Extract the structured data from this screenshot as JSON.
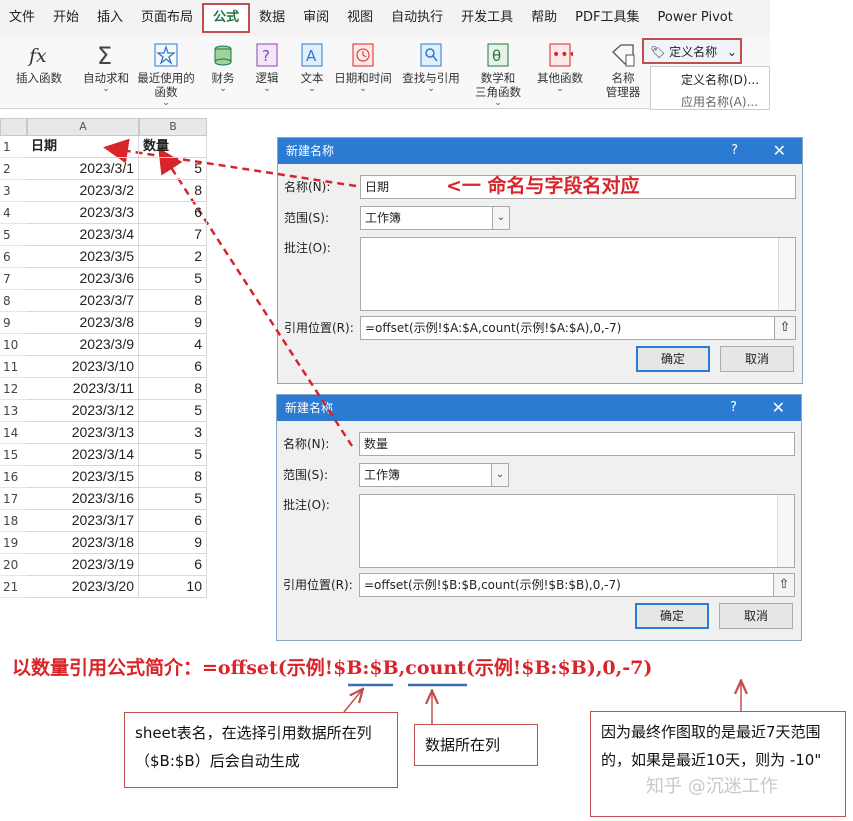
{
  "ribbon": {
    "tabs": [
      "文件",
      "开始",
      "插入",
      "页面布局",
      "公式",
      "数据",
      "审阅",
      "视图",
      "自动执行",
      "开发工具",
      "帮助",
      "PDF工具集",
      "Power Pivot"
    ],
    "active_tab": "公式",
    "buttons": [
      {
        "label": "插入函数",
        "icon": "fx-icon",
        "chevron": ""
      },
      {
        "label": "自动求和",
        "icon": "sigma-icon",
        "chevron": "⌄"
      },
      {
        "label": "最近使用的",
        "label2": "函数",
        "icon": "star-icon",
        "chevron": "⌄"
      },
      {
        "label": "财务",
        "icon": "coins-icon",
        "chevron": "⌄"
      },
      {
        "label": "逻辑",
        "icon": "question-icon",
        "chevron": "⌄"
      },
      {
        "label": "文本",
        "icon": "text-icon",
        "chevron": "⌄"
      },
      {
        "label": "日期和时间",
        "icon": "clock-icon",
        "chevron": "⌄"
      },
      {
        "label": "查找与引用",
        "icon": "search-icon",
        "chevron": "⌄"
      },
      {
        "label": "数学和",
        "label2": "三角函数",
        "icon": "theta-icon",
        "chevron": "⌄"
      },
      {
        "label": "其他函数",
        "icon": "dots-icon",
        "chevron": "⌄"
      },
      {
        "label": "名称",
        "label2": "管理器",
        "icon": "tag-icon",
        "chevron": ""
      }
    ],
    "define_name": "定义名称",
    "define_name_menu": [
      "定义名称(D)...",
      "应用名称(A)..."
    ]
  },
  "sheet": {
    "col_headers": [
      "A",
      "B"
    ],
    "header_row": {
      "date": "日期",
      "qty": "数量"
    },
    "rows": [
      {
        "n": "1",
        "date": "",
        "qty": ""
      },
      {
        "n": "2",
        "date": "2023/3/1",
        "qty": "5"
      },
      {
        "n": "3",
        "date": "2023/3/2",
        "qty": "8"
      },
      {
        "n": "4",
        "date": "2023/3/3",
        "qty": "6"
      },
      {
        "n": "5",
        "date": "2023/3/4",
        "qty": "7"
      },
      {
        "n": "6",
        "date": "2023/3/5",
        "qty": "2"
      },
      {
        "n": "7",
        "date": "2023/3/6",
        "qty": "5"
      },
      {
        "n": "8",
        "date": "2023/3/7",
        "qty": "8"
      },
      {
        "n": "9",
        "date": "2023/3/8",
        "qty": "9"
      },
      {
        "n": "10",
        "date": "2023/3/9",
        "qty": "4"
      },
      {
        "n": "11",
        "date": "2023/3/10",
        "qty": "6"
      },
      {
        "n": "12",
        "date": "2023/3/11",
        "qty": "8"
      },
      {
        "n": "13",
        "date": "2023/3/12",
        "qty": "5"
      },
      {
        "n": "14",
        "date": "2023/3/13",
        "qty": "3"
      },
      {
        "n": "15",
        "date": "2023/3/14",
        "qty": "5"
      },
      {
        "n": "16",
        "date": "2023/3/15",
        "qty": "8"
      },
      {
        "n": "17",
        "date": "2023/3/16",
        "qty": "5"
      },
      {
        "n": "18",
        "date": "2023/3/17",
        "qty": "6"
      },
      {
        "n": "19",
        "date": "2023/3/18",
        "qty": "9"
      },
      {
        "n": "20",
        "date": "2023/3/19",
        "qty": "6"
      },
      {
        "n": "21",
        "date": "2023/3/20",
        "qty": "10"
      }
    ]
  },
  "dialogs": [
    {
      "title": "新建名称",
      "help": "?",
      "close": "✕",
      "name_label": "名称(N):",
      "name_value": "日期",
      "scope_label": "范围(S):",
      "scope_value": "工作簿",
      "comment_label": "批注(O):",
      "ref_label": "引用位置(R):",
      "ref_value": "=offset(示例!$A:$A,count(示例!$A:$A),0,-7)",
      "ok": "确定",
      "cancel": "取消"
    },
    {
      "title": "新建名称",
      "help": "?",
      "close": "✕",
      "name_label": "名称(N):",
      "name_value": "数量",
      "scope_label": "范围(S):",
      "scope_value": "工作簿",
      "comment_label": "批注(O):",
      "ref_label": "引用位置(R):",
      "ref_value": "=offset(示例!$B:$B,count(示例!$B:$B),0,-7)",
      "ok": "确定",
      "cancel": "取消"
    }
  ],
  "annotations": {
    "name_note": "<一  命名与字段名对应",
    "formula_prefix": "以数量引用公式简介：",
    "formula_code": "=offset(示例!$B:$B,count(示例!$B:$B),0,-7)",
    "callout_sheet": "sheet表名，在选择引用数据所在列（$B:$B）后会自动生成",
    "callout_column": "数据所在列",
    "callout_range": "因为最终作图取的是最近7天范围的，如果是最近10天，则为 -10\"",
    "watermark": "知乎 @沉迷工作"
  },
  "colors": {
    "accent_red": "#d9242a",
    "box_red": "#c0504d",
    "dialog_blue": "#2b7bd3",
    "excel_green": "#217346"
  }
}
